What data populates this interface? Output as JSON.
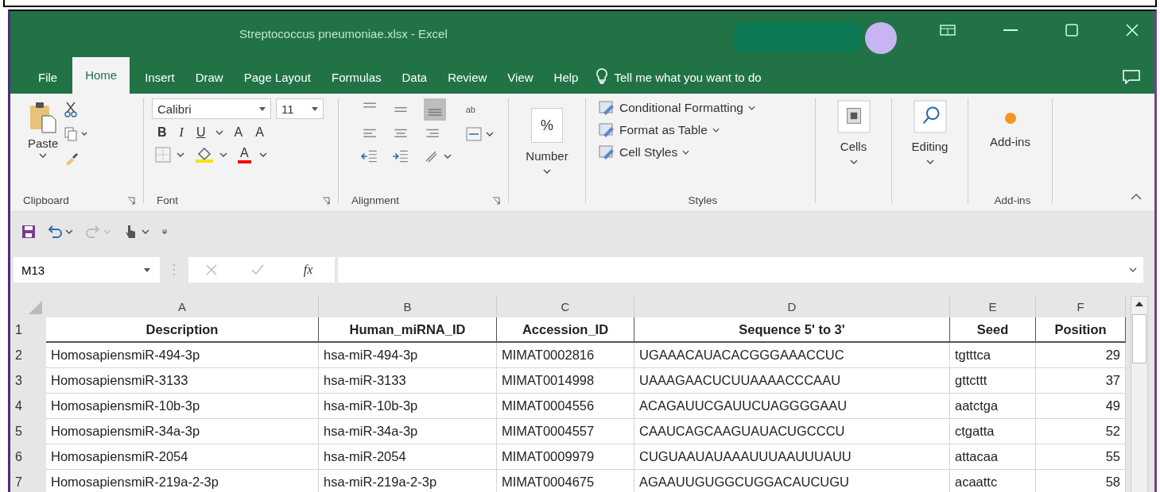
{
  "window": {
    "title": "Streptococcus pneumoniae.xlsx  -  Excel"
  },
  "tabs": [
    {
      "label": "File",
      "selected": false
    },
    {
      "label": "Home",
      "selected": true
    },
    {
      "label": "Insert",
      "selected": false
    },
    {
      "label": "Draw",
      "selected": false
    },
    {
      "label": "Page Layout",
      "selected": false
    },
    {
      "label": "Formulas",
      "selected": false
    },
    {
      "label": "Data",
      "selected": false
    },
    {
      "label": "Review",
      "selected": false
    },
    {
      "label": "View",
      "selected": false
    },
    {
      "label": "Help",
      "selected": false
    }
  ],
  "tell_me": "Tell me what you want to do",
  "ribbon": {
    "clipboard": {
      "paste": "Paste",
      "label": "Clipboard"
    },
    "font": {
      "family": "Calibri",
      "size": "11",
      "bold": "B",
      "italic": "I",
      "underline": "U",
      "grow": "A",
      "shrink": "A",
      "font_color_letter": "A",
      "label": "Font"
    },
    "alignment": {
      "wrap": "ab",
      "label": "Alignment"
    },
    "number": {
      "symbol": "%",
      "button": "Number"
    },
    "styles": {
      "items": [
        "Conditional Formatting",
        "Format as Table",
        "Cell Styles"
      ],
      "label": "Styles"
    },
    "cells": {
      "button": "Cells"
    },
    "editing": {
      "button": "Editing"
    },
    "addins": {
      "button": "Add-ins",
      "label": "Add-ins"
    }
  },
  "formula_bar": {
    "name_box": "M13",
    "fx": "fx"
  },
  "sheet": {
    "columns": [
      "A",
      "B",
      "C",
      "D",
      "E",
      "F"
    ],
    "header": [
      "Description",
      "Human_miRNA_ID",
      "Accession_ID",
      "Sequence 5' to 3'",
      "Seed",
      "Position"
    ],
    "rows": [
      {
        "num": "1"
      },
      {
        "num": "2",
        "cells": [
          "HomosapiensmiR-494-3p",
          "hsa-miR-494-3p",
          "MIMAT0002816",
          "UGAAACAUACACGGGAAACCUC",
          "tgtttca",
          "29"
        ]
      },
      {
        "num": "3",
        "cells": [
          "HomosapiensmiR-3133",
          "hsa-miR-3133",
          "MIMAT0014998",
          "UAAAGAACUCUUAAAACCCAAU",
          "gttcttt",
          "37"
        ]
      },
      {
        "num": "4",
        "cells": [
          "HomosapiensmiR-10b-3p",
          "hsa-miR-10b-3p",
          "MIMAT0004556",
          "ACAGAUUCGAUUCUAGGGGAAU",
          "aatctga",
          "49"
        ]
      },
      {
        "num": "5",
        "cells": [
          "HomosapiensmiR-34a-3p",
          "hsa-miR-34a-3p",
          "MIMAT0004557",
          "CAAUCAGCAAGUAUACUGCCCU",
          "ctgatta",
          "52"
        ]
      },
      {
        "num": "6",
        "cells": [
          "HomosapiensmiR-2054",
          "hsa-miR-2054",
          "MIMAT0009979",
          "CUGUAAUAUAAAUUUAAUUUAUU",
          "attacaa",
          "55"
        ]
      },
      {
        "num": "7",
        "cells": [
          "HomosapiensmiR-219a-2-3p",
          "hsa-miR-219a-2-3p",
          "MIMAT0004675",
          "AGAAUUGUGGCUGGACAUCUGU",
          "acaattc",
          "58"
        ]
      }
    ]
  }
}
